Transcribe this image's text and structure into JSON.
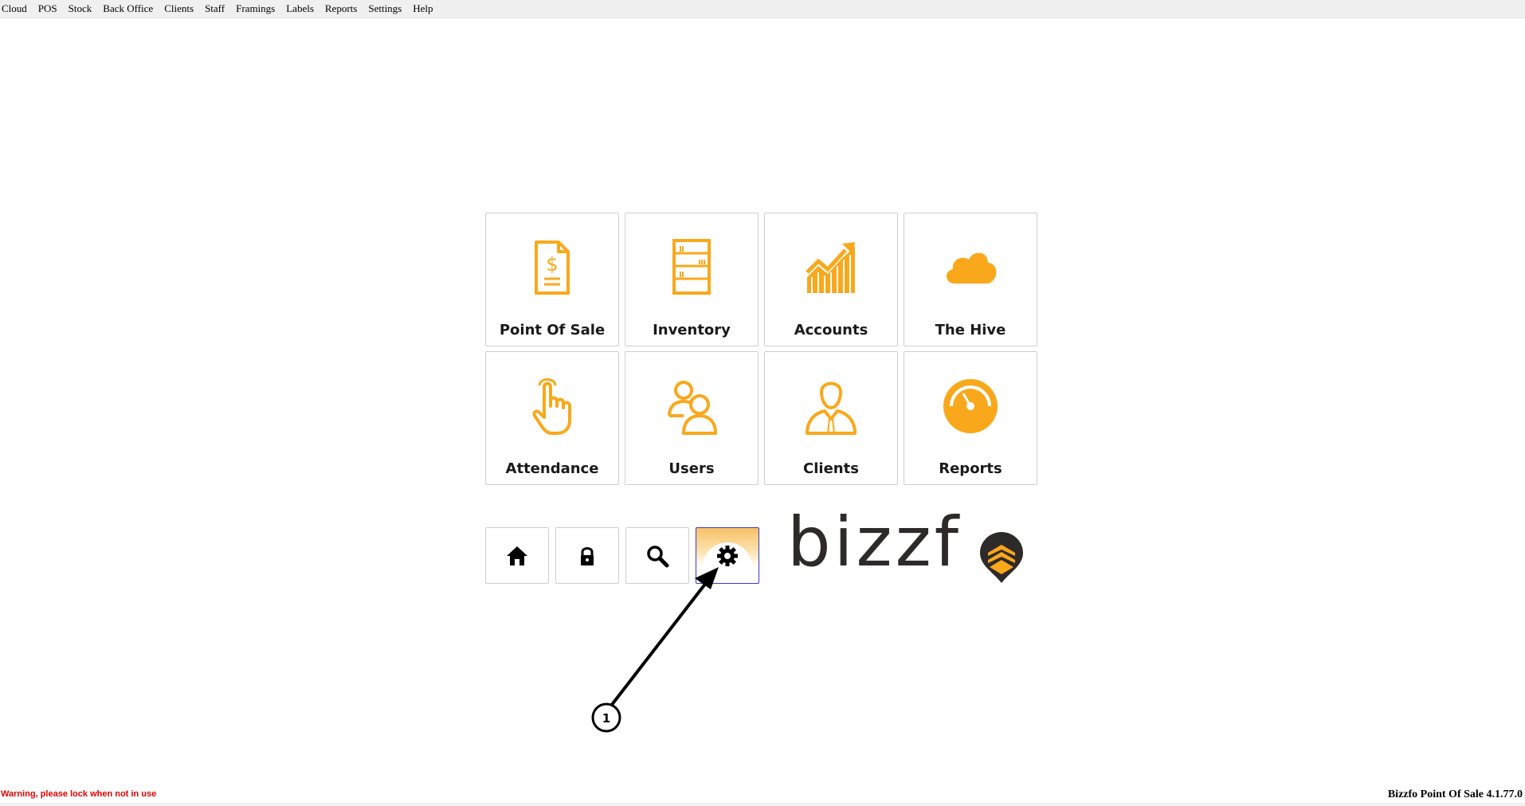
{
  "menu": {
    "items": [
      {
        "label": "Cloud"
      },
      {
        "label": "POS"
      },
      {
        "label": "Stock"
      },
      {
        "label": "Back Office"
      },
      {
        "label": "Clients"
      },
      {
        "label": "Staff"
      },
      {
        "label": "Framings"
      },
      {
        "label": "Labels"
      },
      {
        "label": "Reports"
      },
      {
        "label": "Settings"
      },
      {
        "label": "Help"
      }
    ]
  },
  "tiles": [
    {
      "label": "Point Of Sale",
      "icon": "invoice-icon"
    },
    {
      "label": "Inventory",
      "icon": "shelves-icon"
    },
    {
      "label": "Accounts",
      "icon": "growth-chart-icon"
    },
    {
      "label": "The Hive",
      "icon": "cloud-icon"
    },
    {
      "label": "Attendance",
      "icon": "hand-pointer-icon"
    },
    {
      "label": "Users",
      "icon": "users-icon"
    },
    {
      "label": "Clients",
      "icon": "client-icon"
    },
    {
      "label": "Reports",
      "icon": "gauge-icon"
    }
  ],
  "toolbar": {
    "buttons": [
      {
        "icon": "home-icon"
      },
      {
        "icon": "lock-icon"
      },
      {
        "icon": "search-icon"
      },
      {
        "icon": "gear-icon",
        "active": true
      }
    ]
  },
  "logo": {
    "text": "bizzf",
    "icon": "bee-icon"
  },
  "annotation": {
    "step": "1"
  },
  "status": {
    "warning": "Warning, please lock when not in use",
    "version": "Bizzfo Point Of Sale 4.1.77.0"
  },
  "colors": {
    "accent": "#F9A81B",
    "warning": "#E00000",
    "text": "#1A1A1A",
    "logo_dark": "#2F2A2A",
    "active_border": "#3A3AD0"
  }
}
